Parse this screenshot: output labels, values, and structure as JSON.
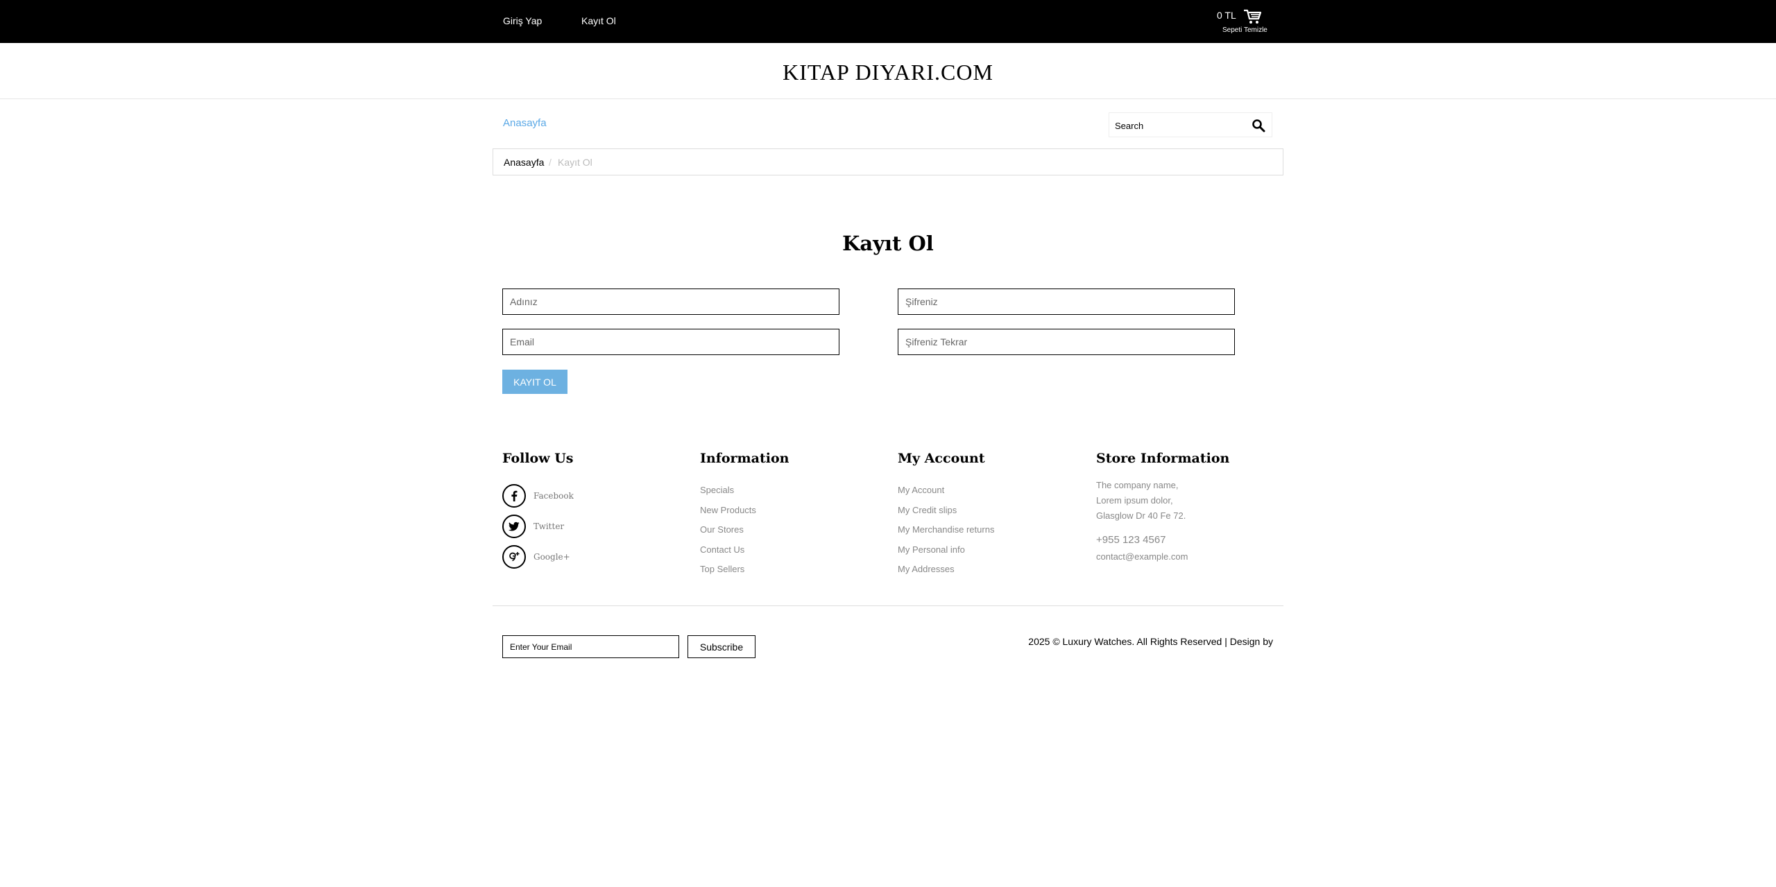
{
  "topbar": {
    "login": "Giriş Yap",
    "register": "Kayıt Ol",
    "cart_total": "0 TL",
    "cart_empty": "Sepeti Temizle"
  },
  "header": {
    "logo": "KITAP DIYARI.COM"
  },
  "nav": {
    "home": "Anasayfa"
  },
  "search": {
    "placeholder": "Search"
  },
  "breadcrumb": {
    "home": "Anasayfa",
    "separator": "/",
    "current": "Kayıt Ol"
  },
  "form": {
    "title": "Kayıt Ol",
    "name_placeholder": "Adınız",
    "email_placeholder": "Email",
    "password_placeholder": "Şifreniz",
    "password_repeat_placeholder": "Şifreniz Tekrar",
    "submit": "Kayıt Ol"
  },
  "footer": {
    "follow": {
      "title": "Follow Us",
      "items": [
        {
          "label": "Facebook",
          "icon": "facebook-icon"
        },
        {
          "label": "Twitter",
          "icon": "twitter-icon"
        },
        {
          "label": "Google+",
          "icon": "google-plus-icon"
        }
      ]
    },
    "information": {
      "title": "Information",
      "links": [
        "Specials",
        "New Products",
        "Our Stores",
        "Contact Us",
        "Top Sellers"
      ]
    },
    "account": {
      "title": "My Account",
      "links": [
        "My Account",
        "My Credit slips",
        "My Merchandise returns",
        "My Personal info",
        "My Addresses"
      ]
    },
    "store": {
      "title": "Store Information",
      "address": [
        "The company name,",
        "Lorem ipsum dolor,",
        "Glasglow Dr 40 Fe 72."
      ],
      "phone": "+955 123 4567",
      "email": "contact@example.com"
    }
  },
  "newsletter": {
    "placeholder": "Enter Your Email",
    "button": "Subscribe"
  },
  "copyright": "2025 © Luxury Watches. All Rights Reserved | Design by",
  "colors": {
    "topbar": "#000000",
    "accent": "#6db1e1",
    "link": "#5aa8e6"
  }
}
